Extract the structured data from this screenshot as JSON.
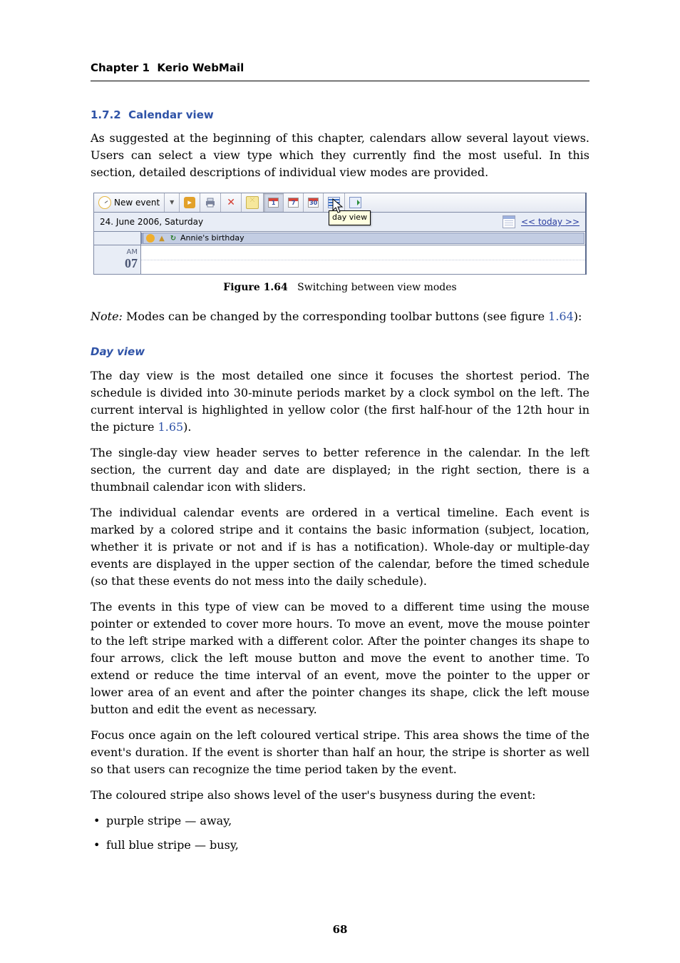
{
  "header": {
    "chapter_label": "Chapter 1",
    "chapter_title": "Kerio WebMail"
  },
  "section": {
    "number": "1.7.2",
    "title": "Calendar view"
  },
  "para_intro": "As suggested at the beginning of this chapter, calendars allow several layout views. Users can select a view type which they currently find the most useful. In this section, detailed descriptions of individual view modes are provided.",
  "figure": {
    "toolbar": {
      "new_event_label": "New event",
      "day_number": "1",
      "week_number": "7",
      "month_number": "30"
    },
    "date_label": "24. June 2006, Saturday",
    "tooltip": "day view",
    "nav_prev": "<<",
    "nav_today": "today",
    "nav_next": ">>",
    "allday_event": "Annie's birthday",
    "time_ampm": "AM",
    "time_hour": "07"
  },
  "fig_caption_label": "Figure 1.64",
  "fig_caption_text": "Switching between view modes",
  "note_prefix": "Note:",
  "note_text_before": " Modes can be changed by the corresponding toolbar buttons (see figure ",
  "note_ref": "1.64",
  "note_text_after": "):",
  "dayview_heading": "Day view",
  "para_dv_1a": "The day view is the most detailed one since it focuses the shortest period. The schedule is divided into 30-minute periods market by a clock symbol on the left. The current interval is highlighted in yellow color (the first half-hour of the 12th hour in the picture ",
  "para_dv_1_ref": "1.65",
  "para_dv_1b": ").",
  "para_dv_2": "The single-day view header serves to better reference in the calendar. In the left section, the current day and date are displayed; in the right section, there is a thumbnail calendar icon with sliders.",
  "para_dv_3": "The individual calendar events are ordered in a vertical timeline. Each event is marked by a colored stripe and it contains the basic information (subject, location, whether it is private or not and if is has a notification). Whole-day or multiple-day events are displayed in the upper section of the calendar, before the timed schedule (so that these events do not mess into the daily schedule).",
  "para_dv_4": "The events in this type of view can be moved to a different time using the mouse pointer or extended to cover more hours. To move an event, move the mouse pointer to the left stripe marked with a different color. After the pointer changes its shape to four arrows, click the left mouse button and move the event to another time. To extend or reduce the time interval of an event, move the pointer to the upper or lower area of an event and after the pointer changes its shape, click the left mouse button and edit the event as necessary.",
  "para_dv_5": "Focus once again on the left coloured vertical stripe. This area shows the time of the event's duration. If the event is shorter than half an hour, the stripe is shorter as well so that users can recognize the time period taken by the event.",
  "para_dv_6": "The coloured stripe also shows level of the user's busyness during the event:",
  "bullet_1": "purple stripe — away,",
  "bullet_2": "full blue stripe — busy,",
  "page_number": "68"
}
